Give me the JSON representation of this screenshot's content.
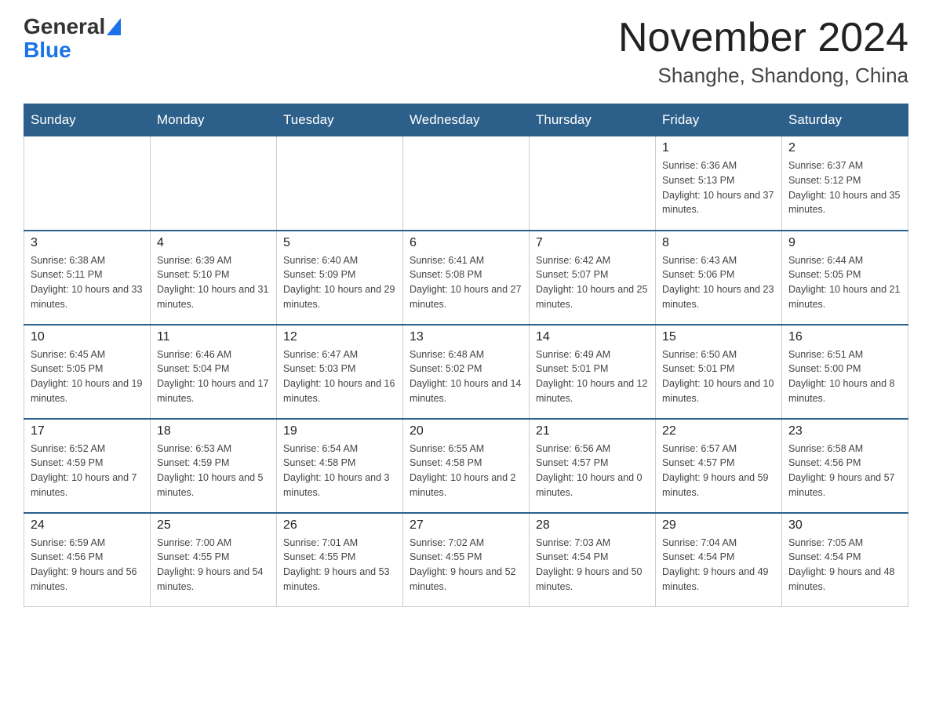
{
  "header": {
    "logo_general": "General",
    "logo_blue": "Blue",
    "month_title": "November 2024",
    "location": "Shanghe, Shandong, China"
  },
  "days_of_week": [
    "Sunday",
    "Monday",
    "Tuesday",
    "Wednesday",
    "Thursday",
    "Friday",
    "Saturday"
  ],
  "weeks": [
    [
      {
        "day": "",
        "info": ""
      },
      {
        "day": "",
        "info": ""
      },
      {
        "day": "",
        "info": ""
      },
      {
        "day": "",
        "info": ""
      },
      {
        "day": "",
        "info": ""
      },
      {
        "day": "1",
        "info": "Sunrise: 6:36 AM\nSunset: 5:13 PM\nDaylight: 10 hours and 37 minutes."
      },
      {
        "day": "2",
        "info": "Sunrise: 6:37 AM\nSunset: 5:12 PM\nDaylight: 10 hours and 35 minutes."
      }
    ],
    [
      {
        "day": "3",
        "info": "Sunrise: 6:38 AM\nSunset: 5:11 PM\nDaylight: 10 hours and 33 minutes."
      },
      {
        "day": "4",
        "info": "Sunrise: 6:39 AM\nSunset: 5:10 PM\nDaylight: 10 hours and 31 minutes."
      },
      {
        "day": "5",
        "info": "Sunrise: 6:40 AM\nSunset: 5:09 PM\nDaylight: 10 hours and 29 minutes."
      },
      {
        "day": "6",
        "info": "Sunrise: 6:41 AM\nSunset: 5:08 PM\nDaylight: 10 hours and 27 minutes."
      },
      {
        "day": "7",
        "info": "Sunrise: 6:42 AM\nSunset: 5:07 PM\nDaylight: 10 hours and 25 minutes."
      },
      {
        "day": "8",
        "info": "Sunrise: 6:43 AM\nSunset: 5:06 PM\nDaylight: 10 hours and 23 minutes."
      },
      {
        "day": "9",
        "info": "Sunrise: 6:44 AM\nSunset: 5:05 PM\nDaylight: 10 hours and 21 minutes."
      }
    ],
    [
      {
        "day": "10",
        "info": "Sunrise: 6:45 AM\nSunset: 5:05 PM\nDaylight: 10 hours and 19 minutes."
      },
      {
        "day": "11",
        "info": "Sunrise: 6:46 AM\nSunset: 5:04 PM\nDaylight: 10 hours and 17 minutes."
      },
      {
        "day": "12",
        "info": "Sunrise: 6:47 AM\nSunset: 5:03 PM\nDaylight: 10 hours and 16 minutes."
      },
      {
        "day": "13",
        "info": "Sunrise: 6:48 AM\nSunset: 5:02 PM\nDaylight: 10 hours and 14 minutes."
      },
      {
        "day": "14",
        "info": "Sunrise: 6:49 AM\nSunset: 5:01 PM\nDaylight: 10 hours and 12 minutes."
      },
      {
        "day": "15",
        "info": "Sunrise: 6:50 AM\nSunset: 5:01 PM\nDaylight: 10 hours and 10 minutes."
      },
      {
        "day": "16",
        "info": "Sunrise: 6:51 AM\nSunset: 5:00 PM\nDaylight: 10 hours and 8 minutes."
      }
    ],
    [
      {
        "day": "17",
        "info": "Sunrise: 6:52 AM\nSunset: 4:59 PM\nDaylight: 10 hours and 7 minutes."
      },
      {
        "day": "18",
        "info": "Sunrise: 6:53 AM\nSunset: 4:59 PM\nDaylight: 10 hours and 5 minutes."
      },
      {
        "day": "19",
        "info": "Sunrise: 6:54 AM\nSunset: 4:58 PM\nDaylight: 10 hours and 3 minutes."
      },
      {
        "day": "20",
        "info": "Sunrise: 6:55 AM\nSunset: 4:58 PM\nDaylight: 10 hours and 2 minutes."
      },
      {
        "day": "21",
        "info": "Sunrise: 6:56 AM\nSunset: 4:57 PM\nDaylight: 10 hours and 0 minutes."
      },
      {
        "day": "22",
        "info": "Sunrise: 6:57 AM\nSunset: 4:57 PM\nDaylight: 9 hours and 59 minutes."
      },
      {
        "day": "23",
        "info": "Sunrise: 6:58 AM\nSunset: 4:56 PM\nDaylight: 9 hours and 57 minutes."
      }
    ],
    [
      {
        "day": "24",
        "info": "Sunrise: 6:59 AM\nSunset: 4:56 PM\nDaylight: 9 hours and 56 minutes."
      },
      {
        "day": "25",
        "info": "Sunrise: 7:00 AM\nSunset: 4:55 PM\nDaylight: 9 hours and 54 minutes."
      },
      {
        "day": "26",
        "info": "Sunrise: 7:01 AM\nSunset: 4:55 PM\nDaylight: 9 hours and 53 minutes."
      },
      {
        "day": "27",
        "info": "Sunrise: 7:02 AM\nSunset: 4:55 PM\nDaylight: 9 hours and 52 minutes."
      },
      {
        "day": "28",
        "info": "Sunrise: 7:03 AM\nSunset: 4:54 PM\nDaylight: 9 hours and 50 minutes."
      },
      {
        "day": "29",
        "info": "Sunrise: 7:04 AM\nSunset: 4:54 PM\nDaylight: 9 hours and 49 minutes."
      },
      {
        "day": "30",
        "info": "Sunrise: 7:05 AM\nSunset: 4:54 PM\nDaylight: 9 hours and 48 minutes."
      }
    ]
  ]
}
